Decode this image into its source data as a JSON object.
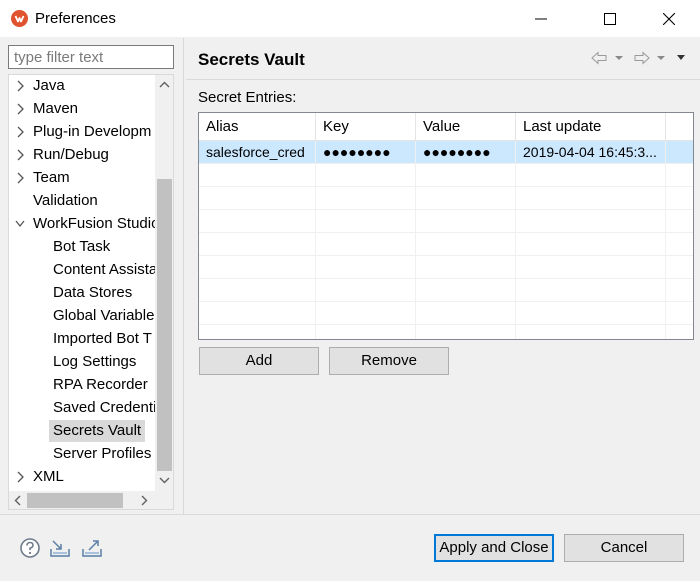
{
  "window": {
    "title": "Preferences",
    "icons": {
      "app": "workfusion-logo-icon",
      "minimize": "minimize-icon",
      "maximize": "maximize-icon",
      "close": "close-icon"
    }
  },
  "sidebar": {
    "filter_placeholder": "type filter text",
    "items": [
      {
        "label": "Java",
        "arrow": "chevron-right-icon"
      },
      {
        "label": "Maven",
        "arrow": "chevron-right-icon"
      },
      {
        "label": "Plug-in Developm",
        "arrow": "chevron-right-icon"
      },
      {
        "label": "Run/Debug",
        "arrow": "chevron-right-icon"
      },
      {
        "label": "Team",
        "arrow": "chevron-right-icon"
      },
      {
        "label": "Validation",
        "arrow": ""
      },
      {
        "label": "WorkFusion Studio",
        "arrow": "chevron-down-icon"
      },
      {
        "label": "Bot Task"
      },
      {
        "label": "Content Assista"
      },
      {
        "label": "Data Stores"
      },
      {
        "label": "Global Variable"
      },
      {
        "label": "Imported Bot T"
      },
      {
        "label": "Log Settings"
      },
      {
        "label": "RPA Recorder"
      },
      {
        "label": "Saved Credenti"
      },
      {
        "label": "Secrets Vault",
        "selected": true
      },
      {
        "label": "Server Profiles"
      },
      {
        "label": "XML",
        "arrow": "chevron-right-icon"
      }
    ]
  },
  "page": {
    "title": "Secrets Vault",
    "nav_icons": [
      "back-arrow-icon",
      "dropdown-icon",
      "forward-arrow-icon",
      "dropdown-icon",
      "view-menu-icon"
    ],
    "section_label": "Secret Entries:",
    "table": {
      "columns": [
        "Alias",
        "Key",
        "Value",
        "Last update"
      ],
      "rows": [
        [
          "salesforce_cred",
          "●●●●●●●●",
          "●●●●●●●●",
          "2019-04-04 16:45:3..."
        ]
      ]
    },
    "add_label": "Add",
    "remove_label": "Remove"
  },
  "footer": {
    "icons": [
      "help-icon",
      "import-icon",
      "export-icon"
    ],
    "apply_label": "Apply and Close",
    "cancel_label": "Cancel"
  }
}
